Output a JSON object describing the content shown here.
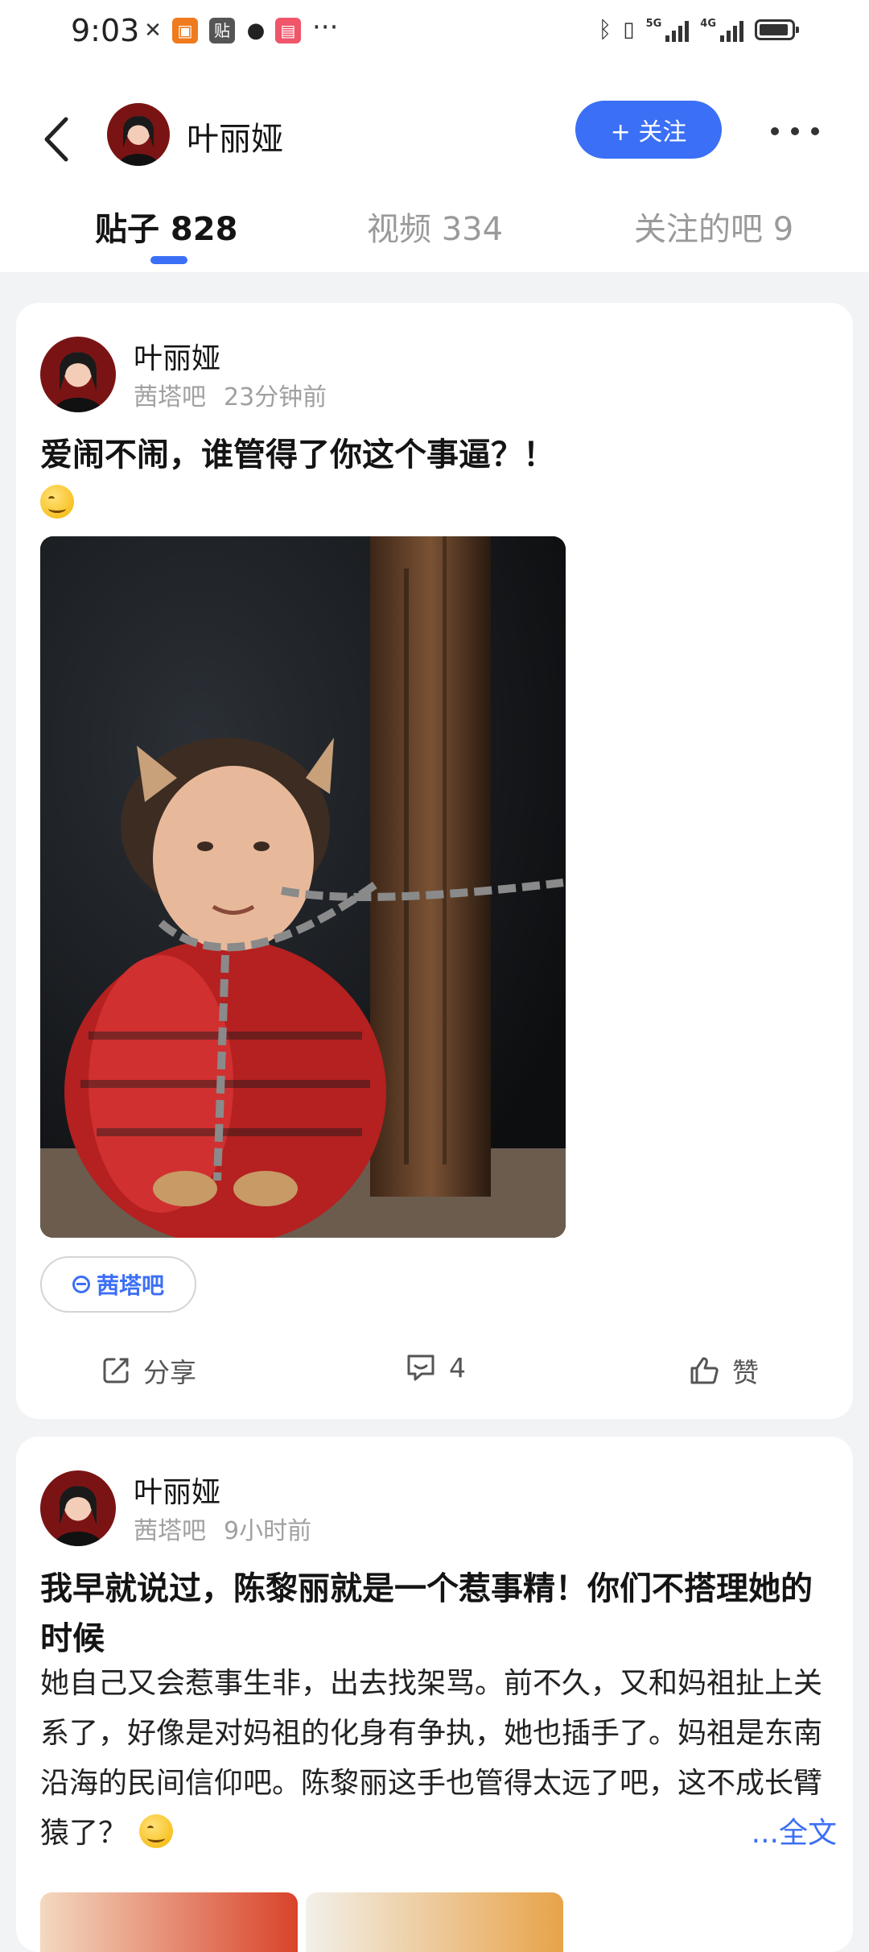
{
  "status_bar": {
    "time": "9:03",
    "icons": [
      "silent-icon",
      "app-icon",
      "tieba-icon",
      "qq-icon",
      "app-icon"
    ],
    "badge_tieba": "贴",
    "network1": "5G",
    "network2": "4G"
  },
  "header": {
    "name": "叶丽娅",
    "follow_label": "+ 关注"
  },
  "tabs": [
    {
      "label": "贴子 828",
      "active": true
    },
    {
      "label": "视频 334",
      "active": false
    },
    {
      "label": "关注的吧 9",
      "active": false
    }
  ],
  "posts": [
    {
      "author": "叶丽娅",
      "forum": "茜塔吧",
      "time": "23分钟前",
      "title": "爱闹不闹，谁管得了你这个事逼？！",
      "forum_tag": "茜塔吧",
      "actions": {
        "share": "分享",
        "comments": "4",
        "like": "赞"
      }
    },
    {
      "author": "叶丽娅",
      "forum": "茜塔吧",
      "time": "9小时前",
      "title": "我早就说过，陈黎丽就是一个惹事精！你们不搭理她的时候",
      "body": "她自己又会惹事生非，出去找架骂。前不久，又和妈祖扯上关系了，好像是对妈祖的化身有争执，她也插手了。妈祖是东南沿海的民间信仰吧。陈黎丽这手也管得太远了吧，这不成长臂猿了？",
      "more_link": "...全文"
    }
  ],
  "colors": {
    "accent": "#3b6ff5",
    "background": "#f2f3f5"
  }
}
